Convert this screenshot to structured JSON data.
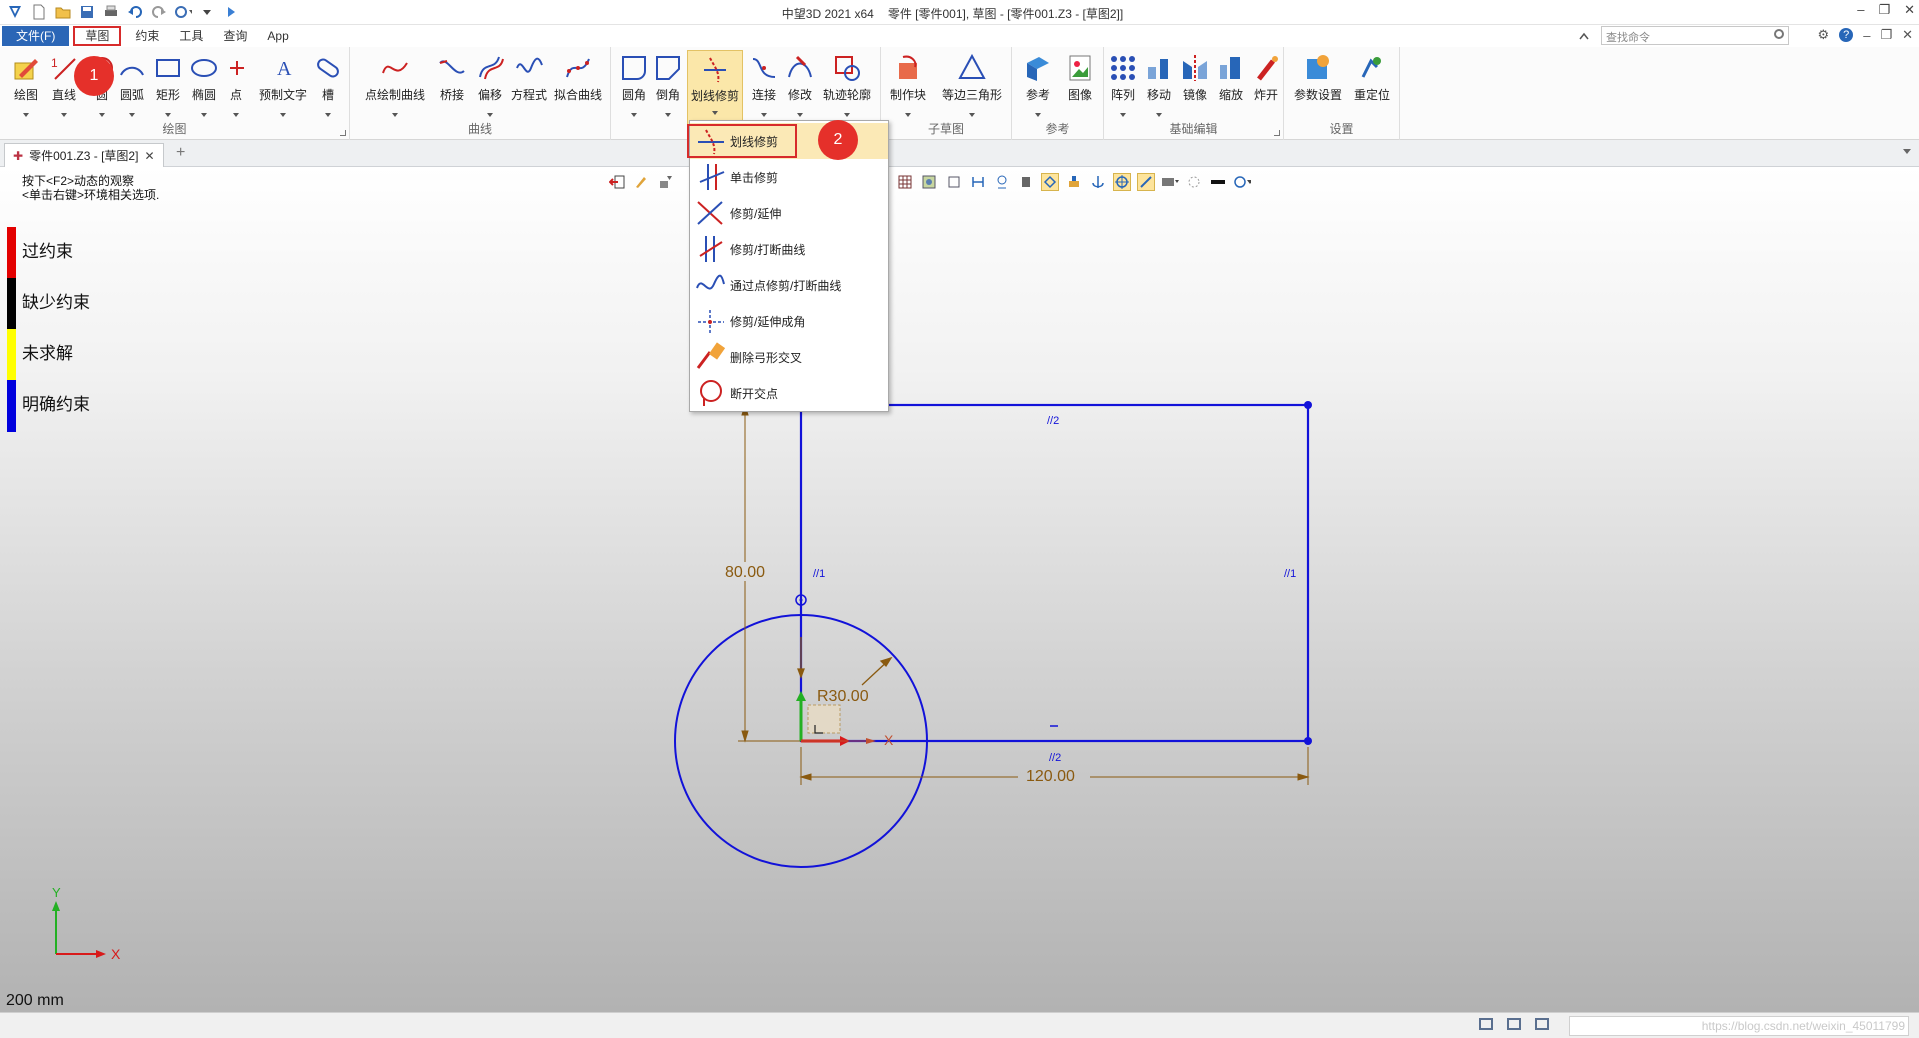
{
  "titlebar": {
    "app": "中望3D 2021 x64",
    "doc": "零件 [零件001], 草图 - [零件001.Z3 - [草图2]]"
  },
  "menubar": {
    "items": [
      "文件(F)",
      "草图",
      "约束",
      "工具",
      "查询",
      "App"
    ],
    "search_placeholder": "查找命令"
  },
  "ribbon": {
    "groups": [
      {
        "label": "绘图",
        "tools": [
          "绘图",
          "直线",
          "圆",
          "圆弧",
          "矩形",
          "椭圆",
          "点",
          "预制文字",
          "槽"
        ]
      },
      {
        "label": "曲线",
        "tools": [
          "点绘制曲线",
          "桥接",
          "偏移",
          "方程式",
          "拟合曲线"
        ]
      },
      {
        "label": "",
        "tools": [
          "圆角",
          "倒角",
          "划线修剪",
          "连接",
          "修改",
          "轨迹轮廓"
        ]
      },
      {
        "label": "子草图",
        "tools": [
          "制作块",
          "等边三角形"
        ]
      },
      {
        "label": "参考",
        "tools": [
          "参考",
          "图像"
        ]
      },
      {
        "label": "基础编辑",
        "tools": [
          "阵列",
          "移动",
          "镜像",
          "缩放",
          "炸开"
        ]
      },
      {
        "label": "设置",
        "tools": [
          "参数设置",
          "重定位"
        ]
      }
    ]
  },
  "doc_tab": {
    "label": "零件001.Z3 - [草图2]"
  },
  "canvas": {
    "hint1": "按下<F2>动态的观察",
    "hint2": "<单击右键>环境相关选项.",
    "legend": [
      {
        "label": "过约束",
        "color": "#e30000"
      },
      {
        "label": "缺少约束",
        "color": "#000000"
      },
      {
        "label": "未求解",
        "color": "#ffff00"
      },
      {
        "label": "明确约束",
        "color": "#0000dd"
      }
    ],
    "scale": "200 mm",
    "dim_height": "80.00",
    "dim_radius": "R30.00",
    "dim_width": "120.00",
    "constraint_parallel_1": "//1",
    "constraint_parallel_2": "//2",
    "axis_x": "X",
    "axis_y": "Y"
  },
  "dropdown": {
    "items": [
      "划线修剪",
      "单击修剪",
      "修剪/延伸",
      "修剪/打断曲线",
      "通过点修剪/打断曲线",
      "修剪/延伸成角",
      "删除弓形交叉",
      "断开交点"
    ]
  },
  "badges": [
    "1",
    "2"
  ],
  "statusbar": {
    "watermark": "https://blog.csdn.net/weixin_45011799"
  },
  "colors": {
    "sketch": "#1212d9",
    "dimension": "#8a5a10",
    "highlight": "#d72b2b"
  }
}
